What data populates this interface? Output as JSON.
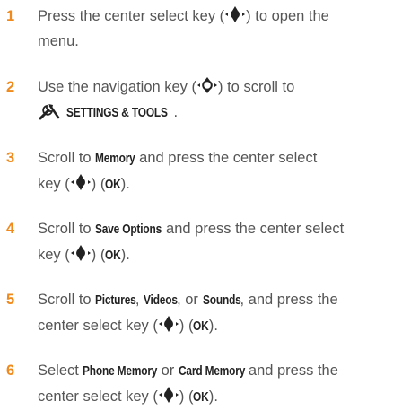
{
  "steps": [
    {
      "num": "1",
      "pre": "Press the center select key (",
      "post": ") to open the",
      "line2": "menu."
    },
    {
      "num": "2",
      "pre": "Use the navigation key (",
      "post": ") to scroll to",
      "settings": "SETTINGS & TOOLS",
      "after": "."
    },
    {
      "num": "3",
      "pre": "Scroll to ",
      "kw1": "Memory",
      "mid": " and press the center select",
      "line2pre": "key (",
      "line2post": ") (",
      "ok": "OK",
      "end": ")."
    },
    {
      "num": "4",
      "pre": "Scroll to ",
      "kw1": "Save Options",
      "mid": " and press the center select",
      "line2pre": "key (",
      "line2post": ") (",
      "ok": "OK",
      "end": ")."
    },
    {
      "num": "5",
      "pre": "Scroll to ",
      "kw1": "Pictures",
      "sep1": ", ",
      "kw2": "Videos",
      "sep2": ", or ",
      "kw3": "Sounds",
      "mid": ", and press the",
      "line2pre": "center select key (",
      "line2post": ") (",
      "ok": "OK",
      "end": ")."
    },
    {
      "num": "6",
      "pre": "Select ",
      "kw1": "Phone Memory",
      "sep1": " or ",
      "kw2": "Card Memory",
      "mid": " and press the",
      "line2pre": "center select key (",
      "line2post": ") (",
      "ok": "OK",
      "end": ")."
    }
  ],
  "icons": {
    "center_key": "center-select-key-icon",
    "nav_key": "navigation-key-icon",
    "tools": "settings-tools-icon"
  },
  "colors": {
    "step_number": "#f08a1c",
    "body_text": "#555555",
    "keyword": "#222222"
  }
}
